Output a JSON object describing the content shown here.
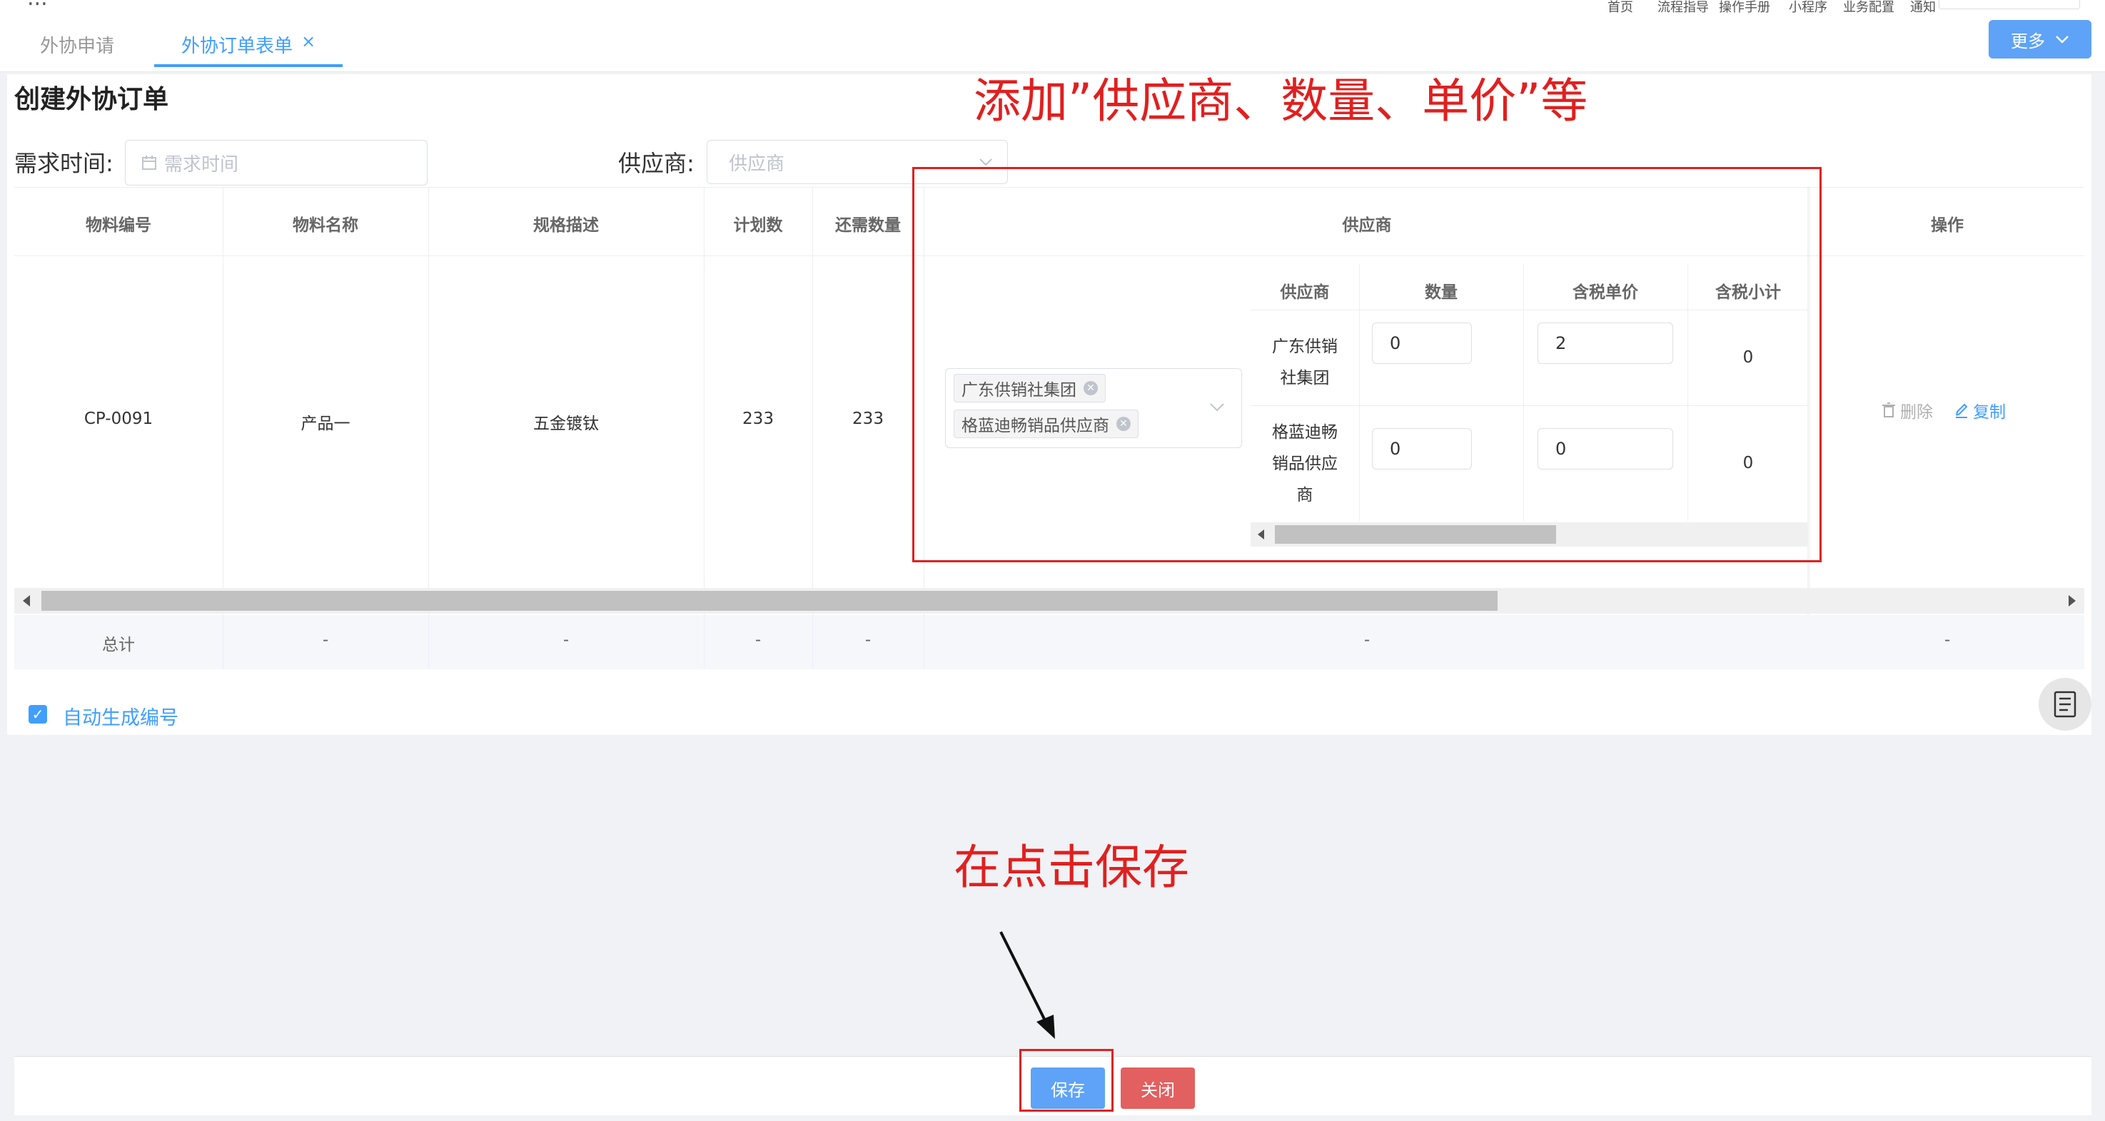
{
  "topnav": {
    "items": [
      "首页",
      "流程指导",
      "操作手册",
      "小程序",
      "业务配置",
      "通知"
    ],
    "menu_glyph": "..."
  },
  "tabs": [
    {
      "label": "外协申请",
      "active": false
    },
    {
      "label": "外协订单表单",
      "active": true,
      "close": "×"
    }
  ],
  "more_button": {
    "label": "更多"
  },
  "page": {
    "title": "创建外协订单"
  },
  "filters": {
    "time_label": "需求时间:",
    "time_placeholder": "需求时间",
    "supplier_label": "供应商:",
    "supplier_placeholder": "供应商"
  },
  "table": {
    "headers": [
      "物料编号",
      "物料名称",
      "规格描述",
      "计划数",
      "还需数量",
      "供应商",
      "操作"
    ],
    "row": {
      "code": "CP-0091",
      "name": "产品一",
      "spec": "五金镀钛",
      "plan": "233",
      "remaining": "233",
      "selected_suppliers": [
        "广东供销社集团",
        "格蓝迪畅销品供应商"
      ]
    },
    "sub_headers": [
      "供应商",
      "数量",
      "含税单价",
      "含税小计"
    ],
    "sub_rows": [
      {
        "supplier_lines": [
          "广东供销",
          "社集团"
        ],
        "qty": "0",
        "price": "2",
        "subtotal": "0"
      },
      {
        "supplier_lines": [
          "格蓝迪畅",
          "销品供应",
          "商"
        ],
        "qty": "0",
        "price": "0",
        "subtotal": "0"
      }
    ],
    "actions": {
      "delete": "删除",
      "copy": "复制"
    },
    "total": {
      "label": "总计",
      "dash": "-"
    }
  },
  "auto_number": {
    "label": "自动生成编号",
    "checked": true
  },
  "annotations": {
    "top": "添加”供应商、数量、单价”等",
    "bottom": "在点击保存"
  },
  "footer": {
    "save": "保存",
    "close": "关闭"
  },
  "colors": {
    "primary": "#409eff",
    "annotation": "#e02020",
    "save": "#5ea3f7",
    "close": "#e36060"
  }
}
